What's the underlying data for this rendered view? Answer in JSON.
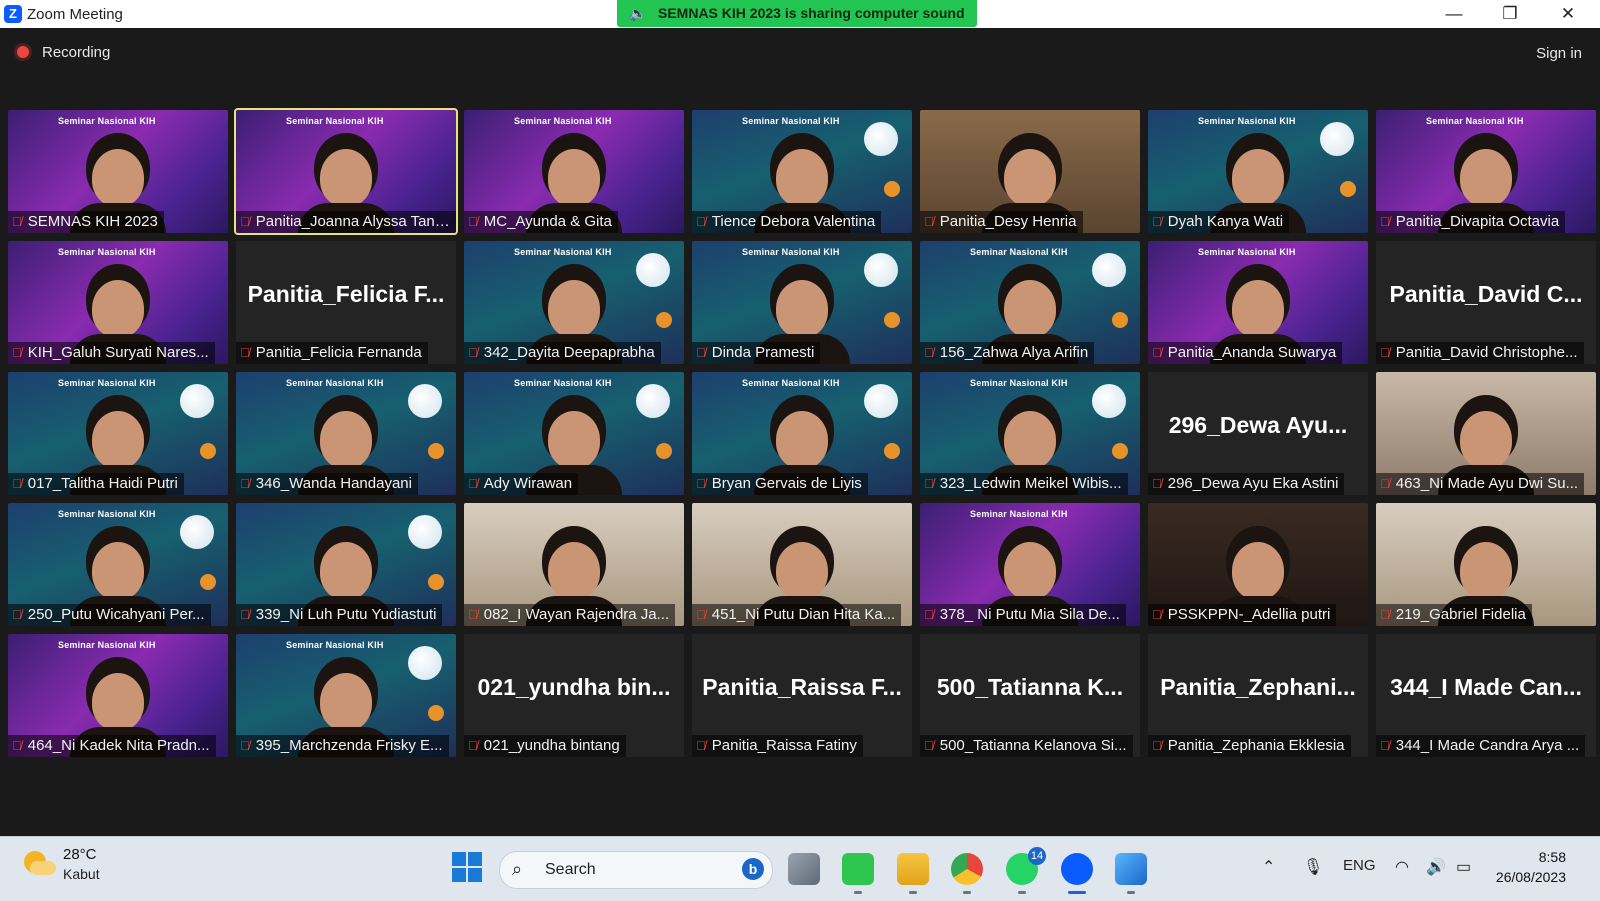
{
  "window": {
    "title": "Zoom Meeting",
    "share_banner": "SEMNAS KIH 2023 is sharing computer sound",
    "minimize": "—",
    "maximize": "❐",
    "close": "✕"
  },
  "toolbar": {
    "recording": "Recording",
    "sign_in": "Sign in"
  },
  "participants": [
    {
      "name": "SEMNAS KIH 2023",
      "video": "purple",
      "banner": "Seminar Nasional KIH"
    },
    {
      "name": "Panitia_Joanna Alyssa Tanur...",
      "video": "purple",
      "banner": "Seminar Nasional KIH",
      "active": true
    },
    {
      "name": "MC_Ayunda & Gita",
      "video": "purple",
      "banner": "Seminar Nasional KIH"
    },
    {
      "name": "Tience Debora Valentina",
      "video": "space",
      "banner": "Seminar Nasional KIH"
    },
    {
      "name": "Panitia_Desy Henria",
      "video": "room"
    },
    {
      "name": "Dyah Kanya Wati",
      "video": "space",
      "banner": "Seminar Nasional KIH"
    },
    {
      "name": "Panitia_Divapita Octavia",
      "video": "purple",
      "banner": "Seminar Nasional KIH"
    },
    {
      "name": "KIH_Galuh Suryati Nares...",
      "video": "purple",
      "banner": "Seminar Nasional KIH"
    },
    {
      "name": "Panitia_Felicia Fernanda",
      "video": "none",
      "big": "Panitia_Felicia F..."
    },
    {
      "name": "342_Dayita Deepaprabha",
      "video": "space",
      "banner": "Seminar Nasional KIH"
    },
    {
      "name": "Dinda Pramesti",
      "video": "space",
      "banner": "Seminar Nasional KIH"
    },
    {
      "name": "156_Zahwa Alya Arifin",
      "video": "space",
      "banner": "Seminar Nasional KIH"
    },
    {
      "name": "Panitia_Ananda Suwarya",
      "video": "purple",
      "banner": "Seminar Nasional KIH"
    },
    {
      "name": "Panitia_David Christophe...",
      "video": "none",
      "big": "Panitia_David C..."
    },
    {
      "name": "017_Talitha Haidi Putri",
      "video": "space",
      "banner": "Seminar Nasional KIH"
    },
    {
      "name": "346_Wanda Handayani",
      "video": "space",
      "banner": "Seminar Nasional KIH"
    },
    {
      "name": "Ady Wirawan",
      "video": "space",
      "banner": "Seminar Nasional KIH"
    },
    {
      "name": "Bryan Gervais de Liyis",
      "video": "space",
      "banner": "Seminar Nasional KIH"
    },
    {
      "name": "323_Ledwin Meikel Wibis...",
      "video": "space",
      "banner": "Seminar Nasional KIH"
    },
    {
      "name": "296_Dewa Ayu Eka Astini",
      "video": "none",
      "big": "296_Dewa  Ayu..."
    },
    {
      "name": "463_Ni Made Ayu Dwi Su...",
      "video": "home"
    },
    {
      "name": "250_Putu Wicahyani Per...",
      "video": "space",
      "banner": "Seminar Nasional KIH"
    },
    {
      "name": "339_Ni Luh Putu Yudiastuti",
      "video": "space"
    },
    {
      "name": "082_I Wayan Rajendra Ja...",
      "video": "beige"
    },
    {
      "name": "451_Ni Putu Dian Hita Ka...",
      "video": "beige"
    },
    {
      "name": "378_ Ni Putu Mia Sila De...",
      "video": "purple",
      "banner": "Seminar Nasional KIH"
    },
    {
      "name": "PSSKPPN-_Adellia putri",
      "video": "dark"
    },
    {
      "name": "219_Gabriel Fidelia",
      "video": "beige"
    },
    {
      "name": "464_Ni Kadek Nita Pradn...",
      "video": "purple",
      "banner": "Seminar Nasional KIH"
    },
    {
      "name": "395_Marchzenda Frisky E...",
      "video": "space",
      "banner": "Seminar Nasional KIH"
    },
    {
      "name": "021_yundha bintang",
      "video": "none",
      "big": "021_yundha  bin..."
    },
    {
      "name": "Panitia_Raissa Fatiny",
      "video": "none",
      "big": "Panitia_Raissa  F..."
    },
    {
      "name": "500_Tatianna Kelanova Si...",
      "video": "none",
      "big": "500_Tatianna  K..."
    },
    {
      "name": "Panitia_Zephania Ekklesia",
      "video": "none",
      "big": "Panitia_Zephani..."
    },
    {
      "name": "344_I Made Candra Arya ...",
      "video": "none",
      "big": "344_I  Made  Can..."
    }
  ],
  "taskbar": {
    "temperature": "28°C",
    "condition": "Kabut",
    "search_placeholder": "Search",
    "whatsapp_badge": "14",
    "language": "ENG",
    "time": "8:58",
    "date": "26/08/2023"
  },
  "colors": {
    "accent_green": "#23c552",
    "active_speaker": "#e8e27a",
    "mute_red": "#e2423b",
    "zoom_blue": "#0b5cff"
  }
}
